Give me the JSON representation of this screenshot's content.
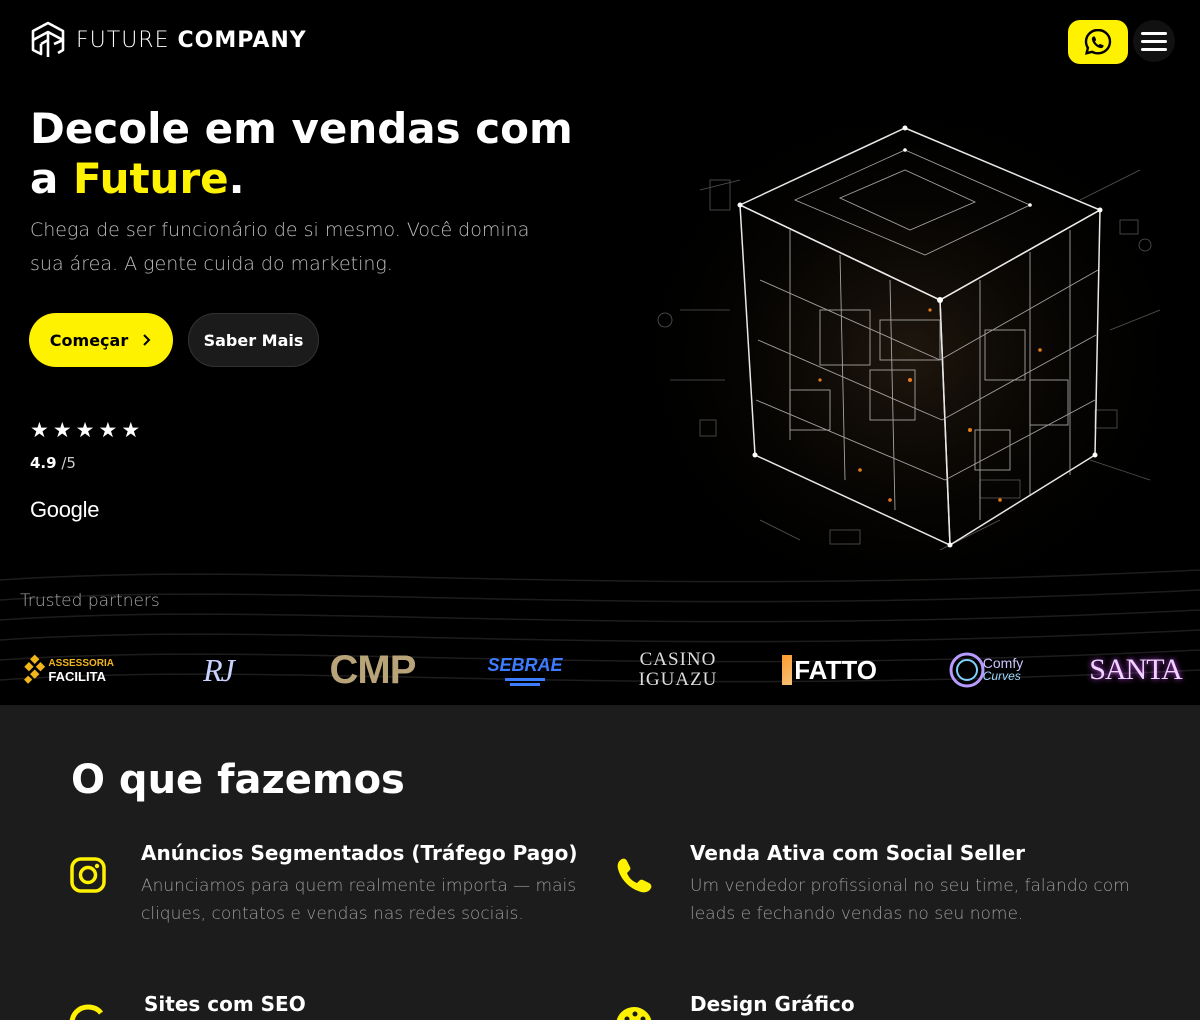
{
  "brand": {
    "name_light": "FUTURE",
    "name_bold": "COMPANY"
  },
  "hero": {
    "title_line1": "Decole em vendas com",
    "title_prefix": "a ",
    "title_accent": "Future",
    "title_suffix": ".",
    "subtitle": "Chega de ser funcionário de si mesmo. Você domina sua área. A gente cuida do marketing.",
    "cta_primary": "Começar",
    "cta_secondary": "Saber Mais"
  },
  "rating": {
    "stars": 5,
    "value": "4.9",
    "max": " /5",
    "source": "Google"
  },
  "trusted": {
    "label": "Trusted partners",
    "logos": [
      {
        "id": "assessoria-facilita",
        "line1": "ASSESSORIA",
        "line2": "FACILITA"
      },
      {
        "id": "rj",
        "text": "RJ"
      },
      {
        "id": "cmp",
        "text": "CMP"
      },
      {
        "id": "sebrae",
        "text": "SEBRAE"
      },
      {
        "id": "casino-iguazu",
        "line1": "CASINO",
        "line2": "IGUAZU"
      },
      {
        "id": "fatto",
        "text": "FATTO"
      },
      {
        "id": "comfy-curves",
        "line1": "Comfy",
        "line2": "Curves"
      },
      {
        "id": "santa",
        "text": "SANTA"
      }
    ]
  },
  "services": {
    "title": "O que fazemos",
    "items": [
      {
        "title": "Anúncios Segmentados (Tráfego Pago)",
        "desc": "Anunciamos para quem realmente importa — mais cliques, contatos e vendas nas redes sociais.",
        "icon": "instagram-icon"
      },
      {
        "title": "Venda Ativa com Social Seller",
        "desc": "Um vendedor profissional no seu time, falando com leads e fechando vendas no seu nome.",
        "icon": "phone-icon"
      },
      {
        "title": "Sites com SEO",
        "desc": "",
        "icon": "google-icon"
      },
      {
        "title": "Design Gráfico",
        "desc": "",
        "icon": "palette-icon"
      }
    ]
  },
  "colors": {
    "accent": "#fff200",
    "background": "#000000",
    "section": "#1c1c1c"
  }
}
